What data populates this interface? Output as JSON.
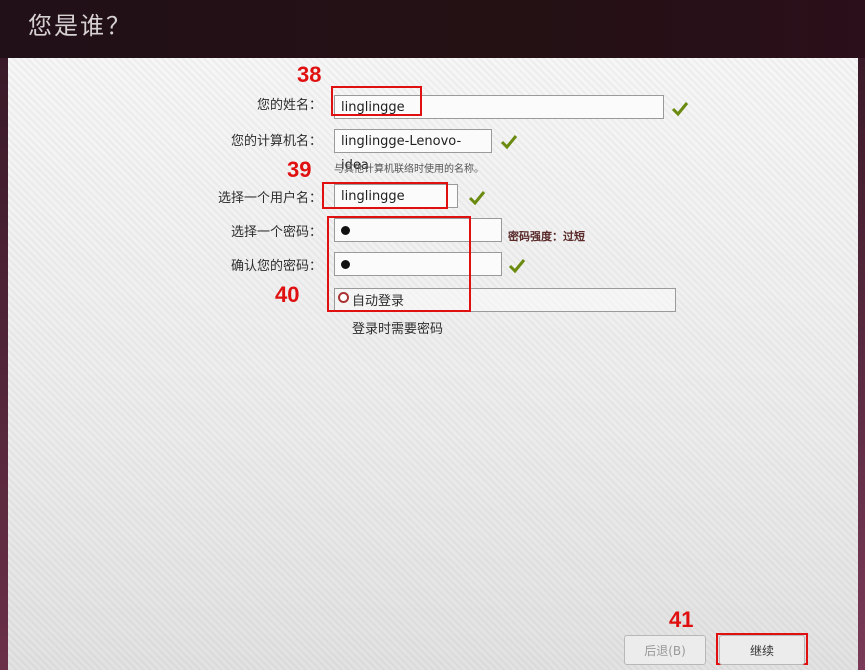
{
  "header": {
    "title": "您是谁？"
  },
  "form": {
    "name_label": "您的姓名：",
    "name_value": "linglingge",
    "computer_label": "您的计算机名：",
    "computer_value": "linglingge-Lenovo-idea",
    "computer_hint": "与其他计算机联络时使用的名称。",
    "username_label": "选择一个用户名：",
    "username_value": "linglingge",
    "password_label": "选择一个密码：",
    "password_strength": "密码强度：过短",
    "confirm_label": "确认您的密码：",
    "auto_login_label": "自动登录",
    "require_password_label": "登录时需要密码"
  },
  "annotations": {
    "n38": "38",
    "n39": "39",
    "n40": "40",
    "n41": "41"
  },
  "footer": {
    "back_label": "后退(B)",
    "continue_label": "继续"
  },
  "colors": {
    "accent_red": "#e01010",
    "check_green": "#6a8a10"
  }
}
